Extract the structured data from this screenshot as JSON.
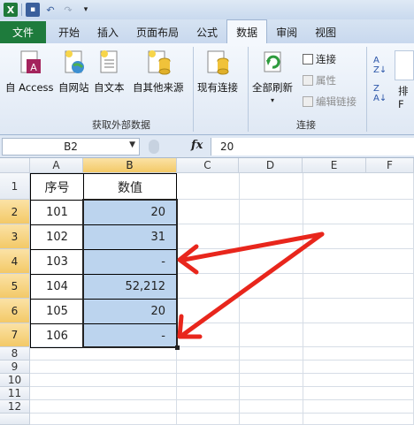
{
  "quick_access": {
    "logo": "X"
  },
  "tabs": [
    "文件",
    "开始",
    "插入",
    "页面布局",
    "公式",
    "数据",
    "审阅",
    "视图"
  ],
  "active_tab": "数据",
  "ribbon": {
    "buttons": [
      "自 Access",
      "自网站",
      "自文本",
      "自其他来源",
      "现有连接",
      "全部刷新"
    ],
    "get_external_label": "获取外部数据",
    "connections_label": "连接",
    "small_items": [
      "连接",
      "属性",
      "编辑链接"
    ],
    "sort_label": "排F"
  },
  "formula_bar": {
    "name_box": "B2",
    "fx": "fx",
    "value": "20"
  },
  "columns": [
    "A",
    "B",
    "C",
    "D",
    "E",
    "F"
  ],
  "rows": [
    "1",
    "2",
    "3",
    "4",
    "5",
    "6",
    "7",
    "8",
    "9",
    "10",
    "11",
    "12"
  ],
  "table": {
    "header": [
      "序号",
      "数值"
    ],
    "rows": [
      [
        "101",
        "20"
      ],
      [
        "102",
        "31"
      ],
      [
        "103",
        "-"
      ],
      [
        "104",
        "52,212"
      ],
      [
        "105",
        "20"
      ],
      [
        "106",
        "-"
      ]
    ]
  },
  "arrow_color": "#e8261c"
}
